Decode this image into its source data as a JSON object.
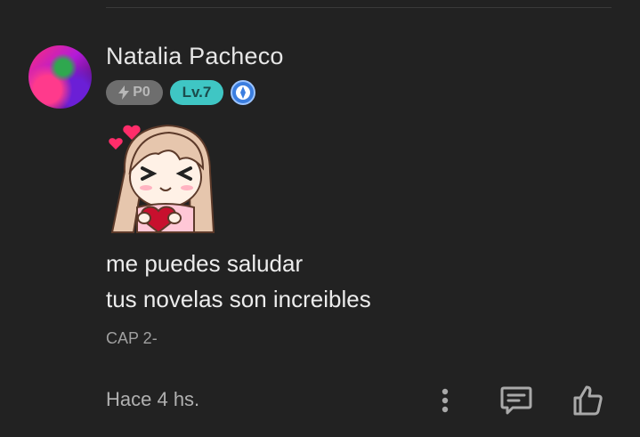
{
  "comment": {
    "username": "Natalia Pacheco",
    "badges": {
      "points_label": "P0",
      "level_label": "Lv.7",
      "colors": {
        "points": "#6e6e6e",
        "level": "#3fc6c4",
        "rank": "#3b7ee0"
      }
    },
    "sticker_icon": "heart-girl-sticker",
    "text_lines": [
      "me puedes saludar",
      "tus novelas son increibles"
    ],
    "chapter": "CAP 2-",
    "time": "Hace 4 hs."
  },
  "actions": [
    "more-options-icon",
    "reply-icon",
    "like-icon"
  ]
}
